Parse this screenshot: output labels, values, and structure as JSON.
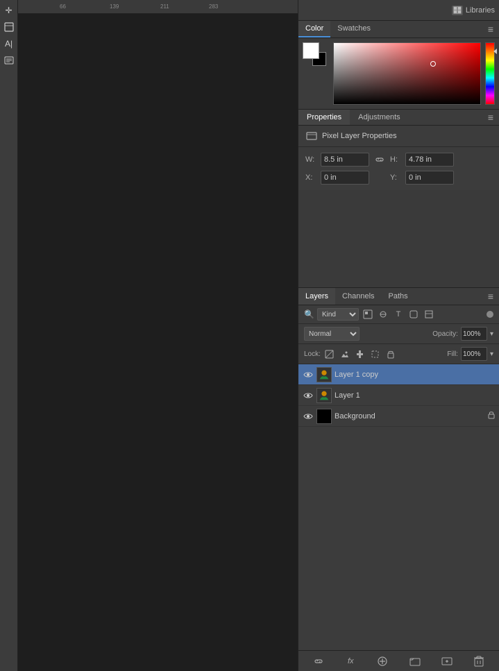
{
  "toolbar": {
    "tools": [
      {
        "name": "move-tool",
        "icon": "✛"
      },
      {
        "name": "select-tool",
        "icon": "⬚"
      },
      {
        "name": "text-tool",
        "icon": "T"
      },
      {
        "name": "shape-tool",
        "icon": "❒"
      }
    ]
  },
  "ruler": {
    "marks": [
      "66",
      "139",
      "211",
      "283"
    ]
  },
  "right_panel": {
    "libraries_btn_label": "Libraries"
  },
  "color_panel": {
    "tabs": [
      {
        "id": "color",
        "label": "Color",
        "active": true
      },
      {
        "id": "swatches",
        "label": "Swatches",
        "active": false
      }
    ]
  },
  "properties_panel": {
    "tabs": [
      {
        "id": "properties",
        "label": "Properties",
        "active": true
      },
      {
        "id": "adjustments",
        "label": "Adjustments",
        "active": false
      }
    ],
    "title": "Pixel Layer Properties",
    "fields": {
      "w_label": "W:",
      "w_value": "8.5 in",
      "h_label": "H:",
      "h_value": "4.78 in",
      "x_label": "X:",
      "x_value": "0 in",
      "y_label": "Y:",
      "y_value": "0 in"
    }
  },
  "layers_panel": {
    "tabs": [
      {
        "id": "layers",
        "label": "Layers",
        "active": true
      },
      {
        "id": "channels",
        "label": "Channels",
        "active": false
      },
      {
        "id": "paths",
        "label": "Paths",
        "active": false
      }
    ],
    "filter": {
      "icon_label": "🔍",
      "kind_label": "Kind"
    },
    "blend_mode": {
      "value": "Normal",
      "opacity_label": "Opacity:",
      "opacity_value": "100%"
    },
    "lock": {
      "label": "Lock:",
      "fill_label": "Fill:",
      "fill_value": "100%"
    },
    "layers": [
      {
        "id": "layer-copy",
        "name": "Layer 1 copy",
        "visible": true,
        "active": true,
        "locked": false,
        "thumb_type": "image"
      },
      {
        "id": "layer-1",
        "name": "Layer 1",
        "visible": true,
        "active": false,
        "locked": false,
        "thumb_type": "image"
      },
      {
        "id": "background",
        "name": "Background",
        "visible": true,
        "active": false,
        "locked": true,
        "thumb_type": "solid"
      }
    ],
    "bottom_bar": {
      "link_icon": "🔗",
      "fx_label": "fx",
      "new_fill_icon": "⬛",
      "new_group_icon": "📁",
      "new_layer_icon": "📄",
      "delete_icon": "🗑"
    }
  }
}
